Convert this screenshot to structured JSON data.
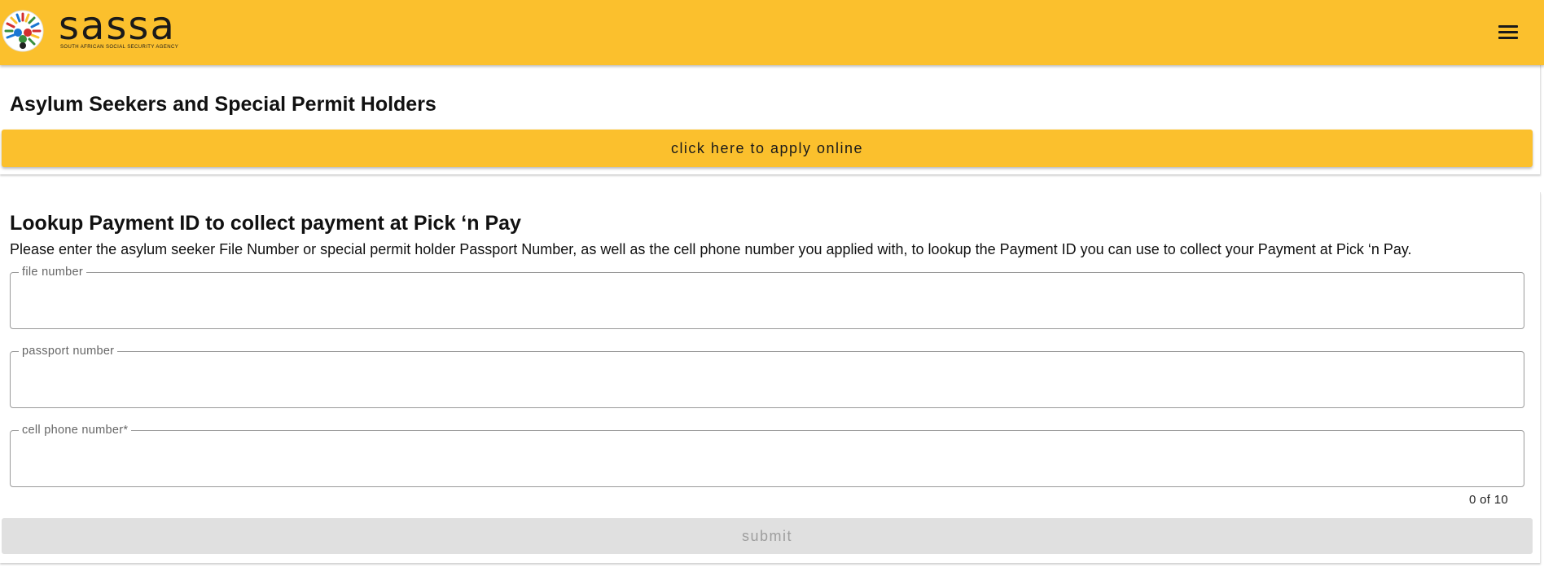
{
  "header": {
    "brand_name": "sassa",
    "brand_tagline": "SOUTH AFRICAN SOCIAL SECURITY AGENCY",
    "logo_icon": "sassa-logo-icon",
    "menu_icon": "hamburger-menu-icon",
    "background_color": "#fbc02d"
  },
  "apply_section": {
    "title": "Asylum Seekers and Special Permit Holders",
    "apply_button_label": "click here to apply online",
    "button_color": "#fbc02d"
  },
  "lookup_section": {
    "title": "Lookup Payment ID to collect payment at Pick ‘n Pay",
    "description": "Please enter the asylum seeker File Number or special permit holder Passport Number, as well as the cell phone number you applied with, to lookup the Payment ID you can use to collect your Payment at Pick ‘n Pay.",
    "fields": {
      "file_number": {
        "label": "file number",
        "value": ""
      },
      "passport_number": {
        "label": "passport number",
        "value": ""
      },
      "cell_phone_number": {
        "label": "cell phone number*",
        "value": ""
      }
    },
    "cell_counter": "0 of 10",
    "submit_label": "submit",
    "submit_state": "disabled"
  }
}
